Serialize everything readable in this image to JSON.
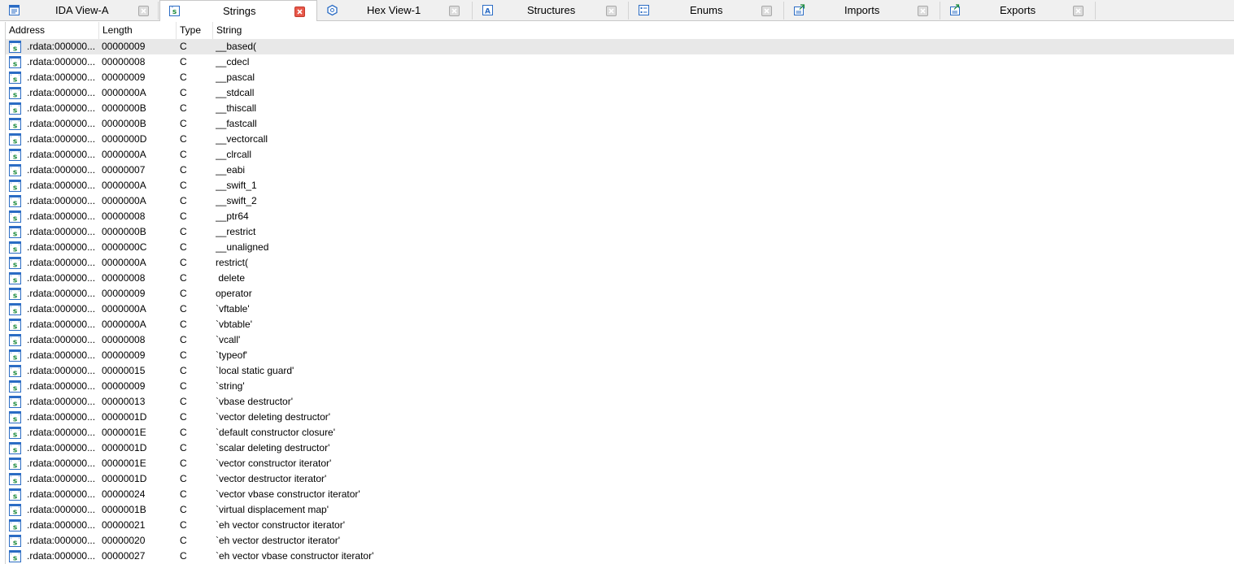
{
  "tabs": [
    {
      "label": "IDA View-A",
      "icon": "ida-view-icon",
      "active": false
    },
    {
      "label": "Strings",
      "icon": "strings-icon",
      "active": true
    },
    {
      "label": "Hex View-1",
      "icon": "hex-view-icon",
      "active": false
    },
    {
      "label": "Structures",
      "icon": "structures-icon",
      "active": false
    },
    {
      "label": "Enums",
      "icon": "enums-icon",
      "active": false
    },
    {
      "label": "Imports",
      "icon": "imports-icon",
      "active": false
    },
    {
      "label": "Exports",
      "icon": "exports-icon",
      "active": false
    }
  ],
  "table": {
    "columns": [
      "Address",
      "Length",
      "Type",
      "String"
    ],
    "rows": [
      {
        "address": ".rdata:000000...",
        "length": "00000009",
        "type": "C",
        "string": "__based("
      },
      {
        "address": ".rdata:000000...",
        "length": "00000008",
        "type": "C",
        "string": "__cdecl"
      },
      {
        "address": ".rdata:000000...",
        "length": "00000009",
        "type": "C",
        "string": "__pascal"
      },
      {
        "address": ".rdata:000000...",
        "length": "0000000A",
        "type": "C",
        "string": "__stdcall"
      },
      {
        "address": ".rdata:000000...",
        "length": "0000000B",
        "type": "C",
        "string": "__thiscall"
      },
      {
        "address": ".rdata:000000...",
        "length": "0000000B",
        "type": "C",
        "string": "__fastcall"
      },
      {
        "address": ".rdata:000000...",
        "length": "0000000D",
        "type": "C",
        "string": "__vectorcall"
      },
      {
        "address": ".rdata:000000...",
        "length": "0000000A",
        "type": "C",
        "string": "__clrcall"
      },
      {
        "address": ".rdata:000000...",
        "length": "00000007",
        "type": "C",
        "string": "__eabi"
      },
      {
        "address": ".rdata:000000...",
        "length": "0000000A",
        "type": "C",
        "string": "__swift_1"
      },
      {
        "address": ".rdata:000000...",
        "length": "0000000A",
        "type": "C",
        "string": "__swift_2"
      },
      {
        "address": ".rdata:000000...",
        "length": "00000008",
        "type": "C",
        "string": "__ptr64"
      },
      {
        "address": ".rdata:000000...",
        "length": "0000000B",
        "type": "C",
        "string": "__restrict"
      },
      {
        "address": ".rdata:000000...",
        "length": "0000000C",
        "type": "C",
        "string": "__unaligned"
      },
      {
        "address": ".rdata:000000...",
        "length": "0000000A",
        "type": "C",
        "string": "restrict("
      },
      {
        "address": ".rdata:000000...",
        "length": "00000008",
        "type": "C",
        "string": " delete"
      },
      {
        "address": ".rdata:000000...",
        "length": "00000009",
        "type": "C",
        "string": "operator"
      },
      {
        "address": ".rdata:000000...",
        "length": "0000000A",
        "type": "C",
        "string": "`vftable'"
      },
      {
        "address": ".rdata:000000...",
        "length": "0000000A",
        "type": "C",
        "string": "`vbtable'"
      },
      {
        "address": ".rdata:000000...",
        "length": "00000008",
        "type": "C",
        "string": "`vcall'"
      },
      {
        "address": ".rdata:000000...",
        "length": "00000009",
        "type": "C",
        "string": "`typeof'"
      },
      {
        "address": ".rdata:000000...",
        "length": "00000015",
        "type": "C",
        "string": "`local static guard'"
      },
      {
        "address": ".rdata:000000...",
        "length": "00000009",
        "type": "C",
        "string": "`string'"
      },
      {
        "address": ".rdata:000000...",
        "length": "00000013",
        "type": "C",
        "string": "`vbase destructor'"
      },
      {
        "address": ".rdata:000000...",
        "length": "0000001D",
        "type": "C",
        "string": "`vector deleting destructor'"
      },
      {
        "address": ".rdata:000000...",
        "length": "0000001E",
        "type": "C",
        "string": "`default constructor closure'"
      },
      {
        "address": ".rdata:000000...",
        "length": "0000001D",
        "type": "C",
        "string": "`scalar deleting destructor'"
      },
      {
        "address": ".rdata:000000...",
        "length": "0000001E",
        "type": "C",
        "string": "`vector constructor iterator'"
      },
      {
        "address": ".rdata:000000...",
        "length": "0000001D",
        "type": "C",
        "string": "`vector destructor iterator'"
      },
      {
        "address": ".rdata:000000...",
        "length": "00000024",
        "type": "C",
        "string": "`vector vbase constructor iterator'"
      },
      {
        "address": ".rdata:000000...",
        "length": "0000001B",
        "type": "C",
        "string": "`virtual displacement map'"
      },
      {
        "address": ".rdata:000000...",
        "length": "00000021",
        "type": "C",
        "string": "`eh vector constructor iterator'"
      },
      {
        "address": ".rdata:000000...",
        "length": "00000020",
        "type": "C",
        "string": "`eh vector destructor iterator'"
      },
      {
        "address": ".rdata:000000...",
        "length": "00000027",
        "type": "C",
        "string": "`eh vector vbase constructor iterator'"
      }
    ]
  },
  "colors": {
    "active_close": "#e8584a",
    "selected_row": "#e8e8e8",
    "icon_blue": "#2b6cc4",
    "icon_green": "#1a8a3a"
  }
}
